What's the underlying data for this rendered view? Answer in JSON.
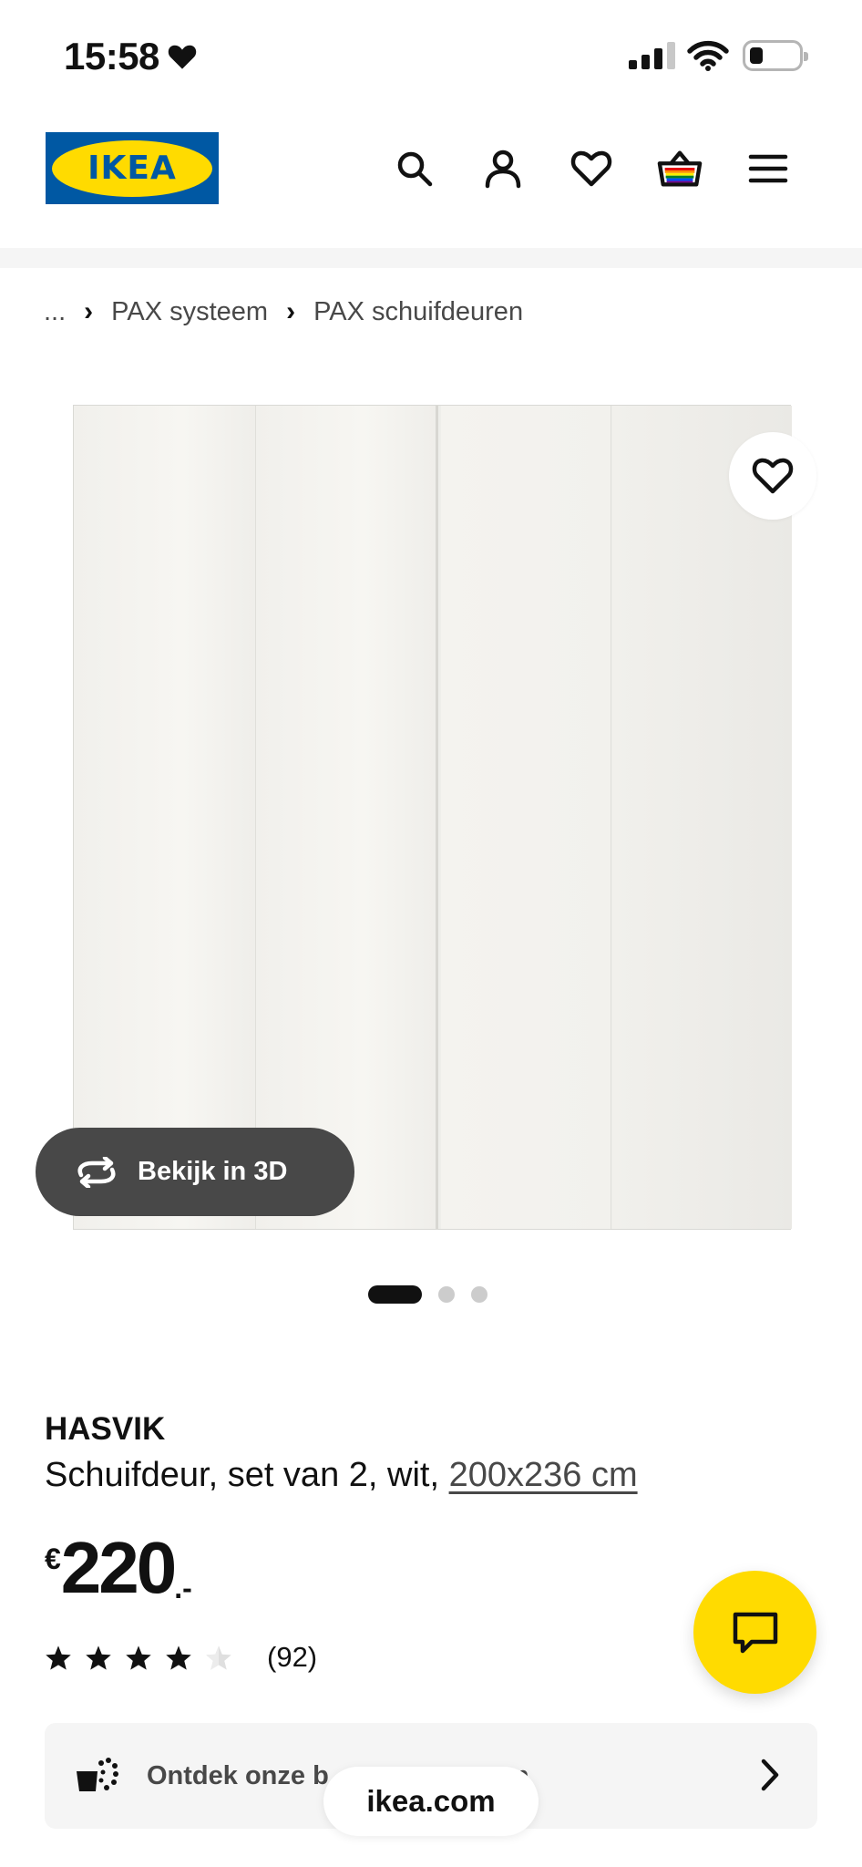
{
  "status_bar": {
    "time": "15:58"
  },
  "header": {
    "logo_text": "IKEA",
    "icons": [
      "search-icon",
      "account-icon",
      "wishlist-icon",
      "cart-icon",
      "menu-icon"
    ]
  },
  "breadcrumb": {
    "ellipsis": "...",
    "items": [
      "PAX systeem",
      "PAX schuifdeuren"
    ]
  },
  "gallery": {
    "view_3d_label": "Bekijk in 3D",
    "dots_total": 3,
    "active_index": 0
  },
  "product": {
    "name": "HASVIK",
    "description": "Schuifdeur, set van 2, wit, ",
    "size": "200x236 cm",
    "price_currency": "€",
    "price_amount": "220",
    "price_suffix": ".-",
    "rating_value": 4.5,
    "rating_count": "(92)"
  },
  "promo": {
    "text": "Ontdek onze b",
    "text_end": "en"
  },
  "browser": {
    "url": "ikea.com"
  },
  "colors": {
    "ikea_blue": "#0058a3",
    "ikea_yellow": "#ffdb00",
    "dark_pill": "#484848"
  }
}
